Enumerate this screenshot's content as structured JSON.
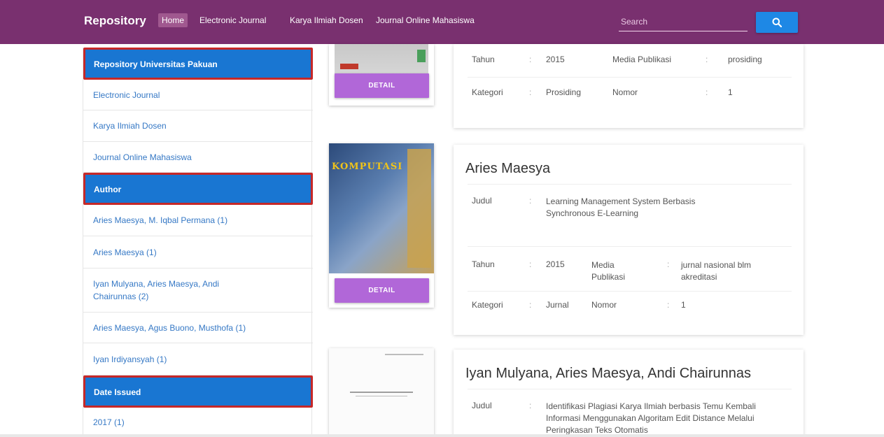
{
  "navbar": {
    "brand": "Repository",
    "links": [
      "Home",
      "Electronic Journal",
      "Karya Ilmiah Dosen",
      "Journal Online Mahasiswa"
    ],
    "search_placeholder": "Search",
    "search_icon": "search-icon"
  },
  "sidebar": {
    "sections": [
      {
        "header": "Repository Universitas Pakuan",
        "items": [
          "Electronic Journal",
          "Karya Ilmiah Dosen",
          "Journal Online Mahasiswa"
        ]
      },
      {
        "header": "Author",
        "items": [
          "Aries Maesya, M. Iqbal Permana (1)",
          "Aries Maesya (1)",
          "Iyan Mulyana, Aries Maesya, Andi Chairunnas (2)",
          "Aries Maesya, Agus Buono, Musthofa (1)",
          "Iyan Irdiyansyah (1)"
        ]
      },
      {
        "header": "Date Issued",
        "items": [
          "2017 (1)"
        ]
      }
    ]
  },
  "detail_label": "DETAIL",
  "labels": {
    "judul": "Judul",
    "tahun": "Tahun",
    "media": "Media Publikasi",
    "kategori": "Kategori",
    "nomor": "Nomor",
    "sep": ":"
  },
  "cards": [
    {
      "title": "",
      "tahun": "2015",
      "media": "prosiding",
      "kategori": "Prosiding",
      "nomor": "1"
    },
    {
      "title": "Aries Maesya",
      "judul": "Learning Management System Berbasis Synchronous E-Learning",
      "tahun": "2015",
      "media": "jurnal nasional blm akreditasi",
      "kategori": "Jurnal",
      "nomor": "1"
    },
    {
      "title": "Iyan Mulyana, Aries Maesya, Andi Chairunnas",
      "judul": "Identifikasi Plagiasi Karya Ilmiah berbasis Temu Kembali Informasi Menggunakan Algoritam Edit Distance Melalui Peringkasan Teks Otomatis"
    }
  ],
  "cover_text": "KOMPUTASI"
}
